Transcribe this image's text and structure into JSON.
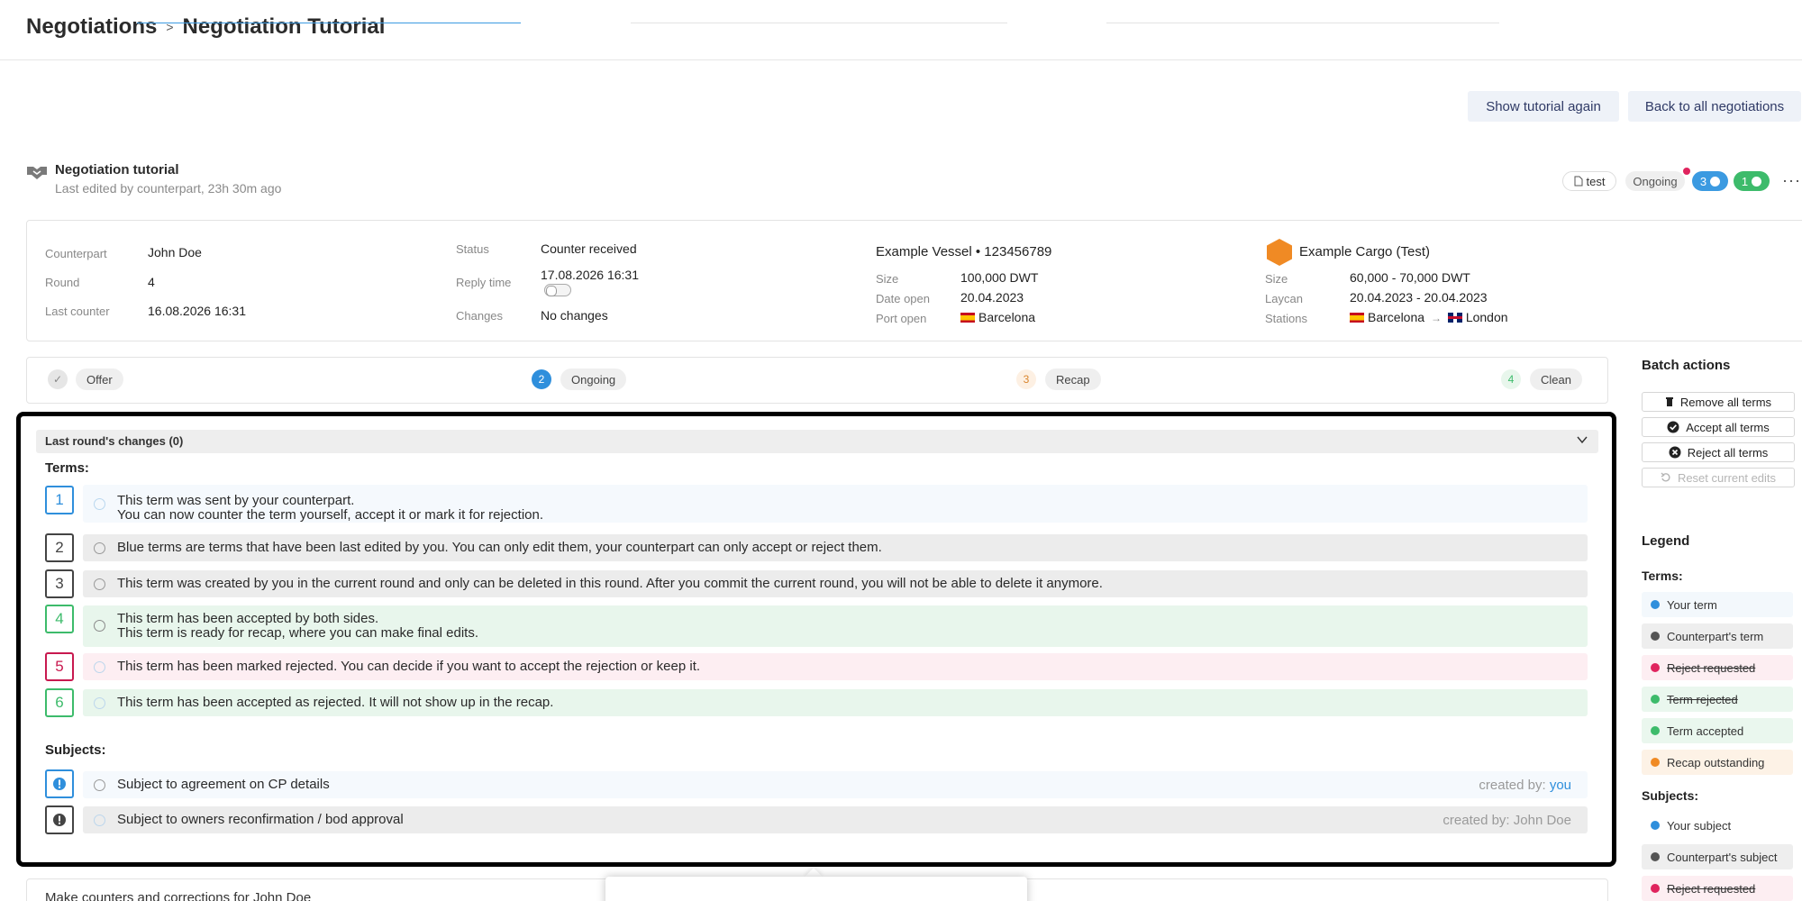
{
  "header": {
    "crumb_root": "Negotiations",
    "crumb_sep": ">",
    "crumb_current": "Negotiation Tutorial"
  },
  "actions": {
    "show_tutorial": "Show tutorial again",
    "back_all": "Back to all negotiations"
  },
  "negotiation": {
    "title": "Negotiation tutorial",
    "subtitle": "Last edited by counterpart, 23h 30m ago",
    "tag": "test",
    "status_pill": "Ongoing",
    "blue_count": "3",
    "green_count": "1",
    "more": "···"
  },
  "info": {
    "counterpart_label": "Counterpart",
    "counterpart": "John Doe",
    "round_label": "Round",
    "round": "4",
    "last_counter_label": "Last counter",
    "last_counter": "16.08.2026 16:31",
    "status_label": "Status",
    "status": "Counter received",
    "reply_label": "Reply time",
    "reply": "17.08.2026 16:31",
    "changes_label": "Changes",
    "changes": "No changes",
    "vessel_title": "Example Vessel • 123456789",
    "v_size_label": "Size",
    "v_size": "100,000 DWT",
    "v_date_label": "Date open",
    "v_date": "20.04.2023",
    "v_port_label": "Port open",
    "v_port": "Barcelona",
    "cargo_title": "Example Cargo (Test)",
    "c_size_label": "Size",
    "c_size": "60,000 - 70,000 DWT",
    "c_laycan_label": "Laycan",
    "c_laycan": "20.04.2023 - 20.04.2023",
    "c_stations_label": "Stations",
    "c_from": "Barcelona",
    "c_arrow": "→",
    "c_to": "London"
  },
  "steps": [
    {
      "num": "✓",
      "label": "Offer"
    },
    {
      "num": "2",
      "label": "Ongoing"
    },
    {
      "num": "3",
      "label": "Recap"
    },
    {
      "num": "4",
      "label": "Clean"
    }
  ],
  "panel": {
    "bar_title": "Last round's changes (0)",
    "terms_title": "Terms:",
    "subjects_title": "Subjects:",
    "terms": [
      {
        "num": "1",
        "line1": "This term was sent by your counterpart.",
        "line2": "You can now counter the term yourself, accept it or mark it for rejection."
      },
      {
        "num": "2",
        "line1": "Blue terms are terms that have been last edited by you. You can only edit them, your counterpart can only accept or reject them.",
        "line2": ""
      },
      {
        "num": "3",
        "line1": "This term was created by you in the current round and only can be deleted in this round. After you commit the current round, you will not be able to delete it anymore.",
        "line2": ""
      },
      {
        "num": "4",
        "line1": "This term has been accepted by both sides.",
        "line2": "This term is ready for recap, where you can make final edits."
      },
      {
        "num": "5",
        "line1": "This term has been marked rejected. You can decide if you want to accept the rejection or keep it.",
        "line2": ""
      },
      {
        "num": "6",
        "line1": "This term has been accepted as rejected. It will not show up in the recap.",
        "line2": ""
      }
    ],
    "subjects": [
      {
        "text": "Subject to agreement on CP details",
        "created_prefix": "created by: ",
        "created_by": "you"
      },
      {
        "text": "Subject to owners reconfirmation / bod approval",
        "created_prefix": "created by: ",
        "created_by": "John Doe"
      }
    ]
  },
  "batch": {
    "title": "Batch actions",
    "remove": "Remove all terms",
    "accept": "Accept all terms",
    "reject": "Reject all terms",
    "reset": "Reset current edits"
  },
  "legend": {
    "title": "Legend",
    "terms_title": "Terms:",
    "terms": [
      {
        "label": "Your term",
        "color": "#2f8fdc",
        "bg": "#f3f8fc"
      },
      {
        "label": "Counterpart's term",
        "color": "#555555",
        "bg": "#eeeeee"
      },
      {
        "label": "Reject requested",
        "color": "#e0245e",
        "bg": "#fdeef2"
      },
      {
        "label": "Term rejected",
        "color": "#3dbb6b",
        "bg": "#eaf7ee"
      },
      {
        "label": "Term accepted",
        "color": "#3dbb6b",
        "bg": "#eaf7ee"
      },
      {
        "label": "Recap outstanding",
        "color": "#f08a24",
        "bg": "#fdf2e6"
      }
    ],
    "subjects_title": "Subjects:",
    "subjects": [
      {
        "label": "Your subject",
        "color": "#2f8fdc",
        "bg": "#ffffff"
      },
      {
        "label": "Counterpart's subject",
        "color": "#555555",
        "bg": "#eeeeee"
      },
      {
        "label": "Reject requested",
        "color": "#e0245e",
        "bg": "#fdeef2"
      }
    ]
  },
  "bottom": {
    "text_prefix": "Make counters and corrections for ",
    "text_name": "John Doe"
  },
  "colors": {
    "blue": "#2f8fdc",
    "green": "#3dbb6b",
    "red": "#c8194f",
    "gray": "#444444",
    "orange": "#f08a24"
  }
}
